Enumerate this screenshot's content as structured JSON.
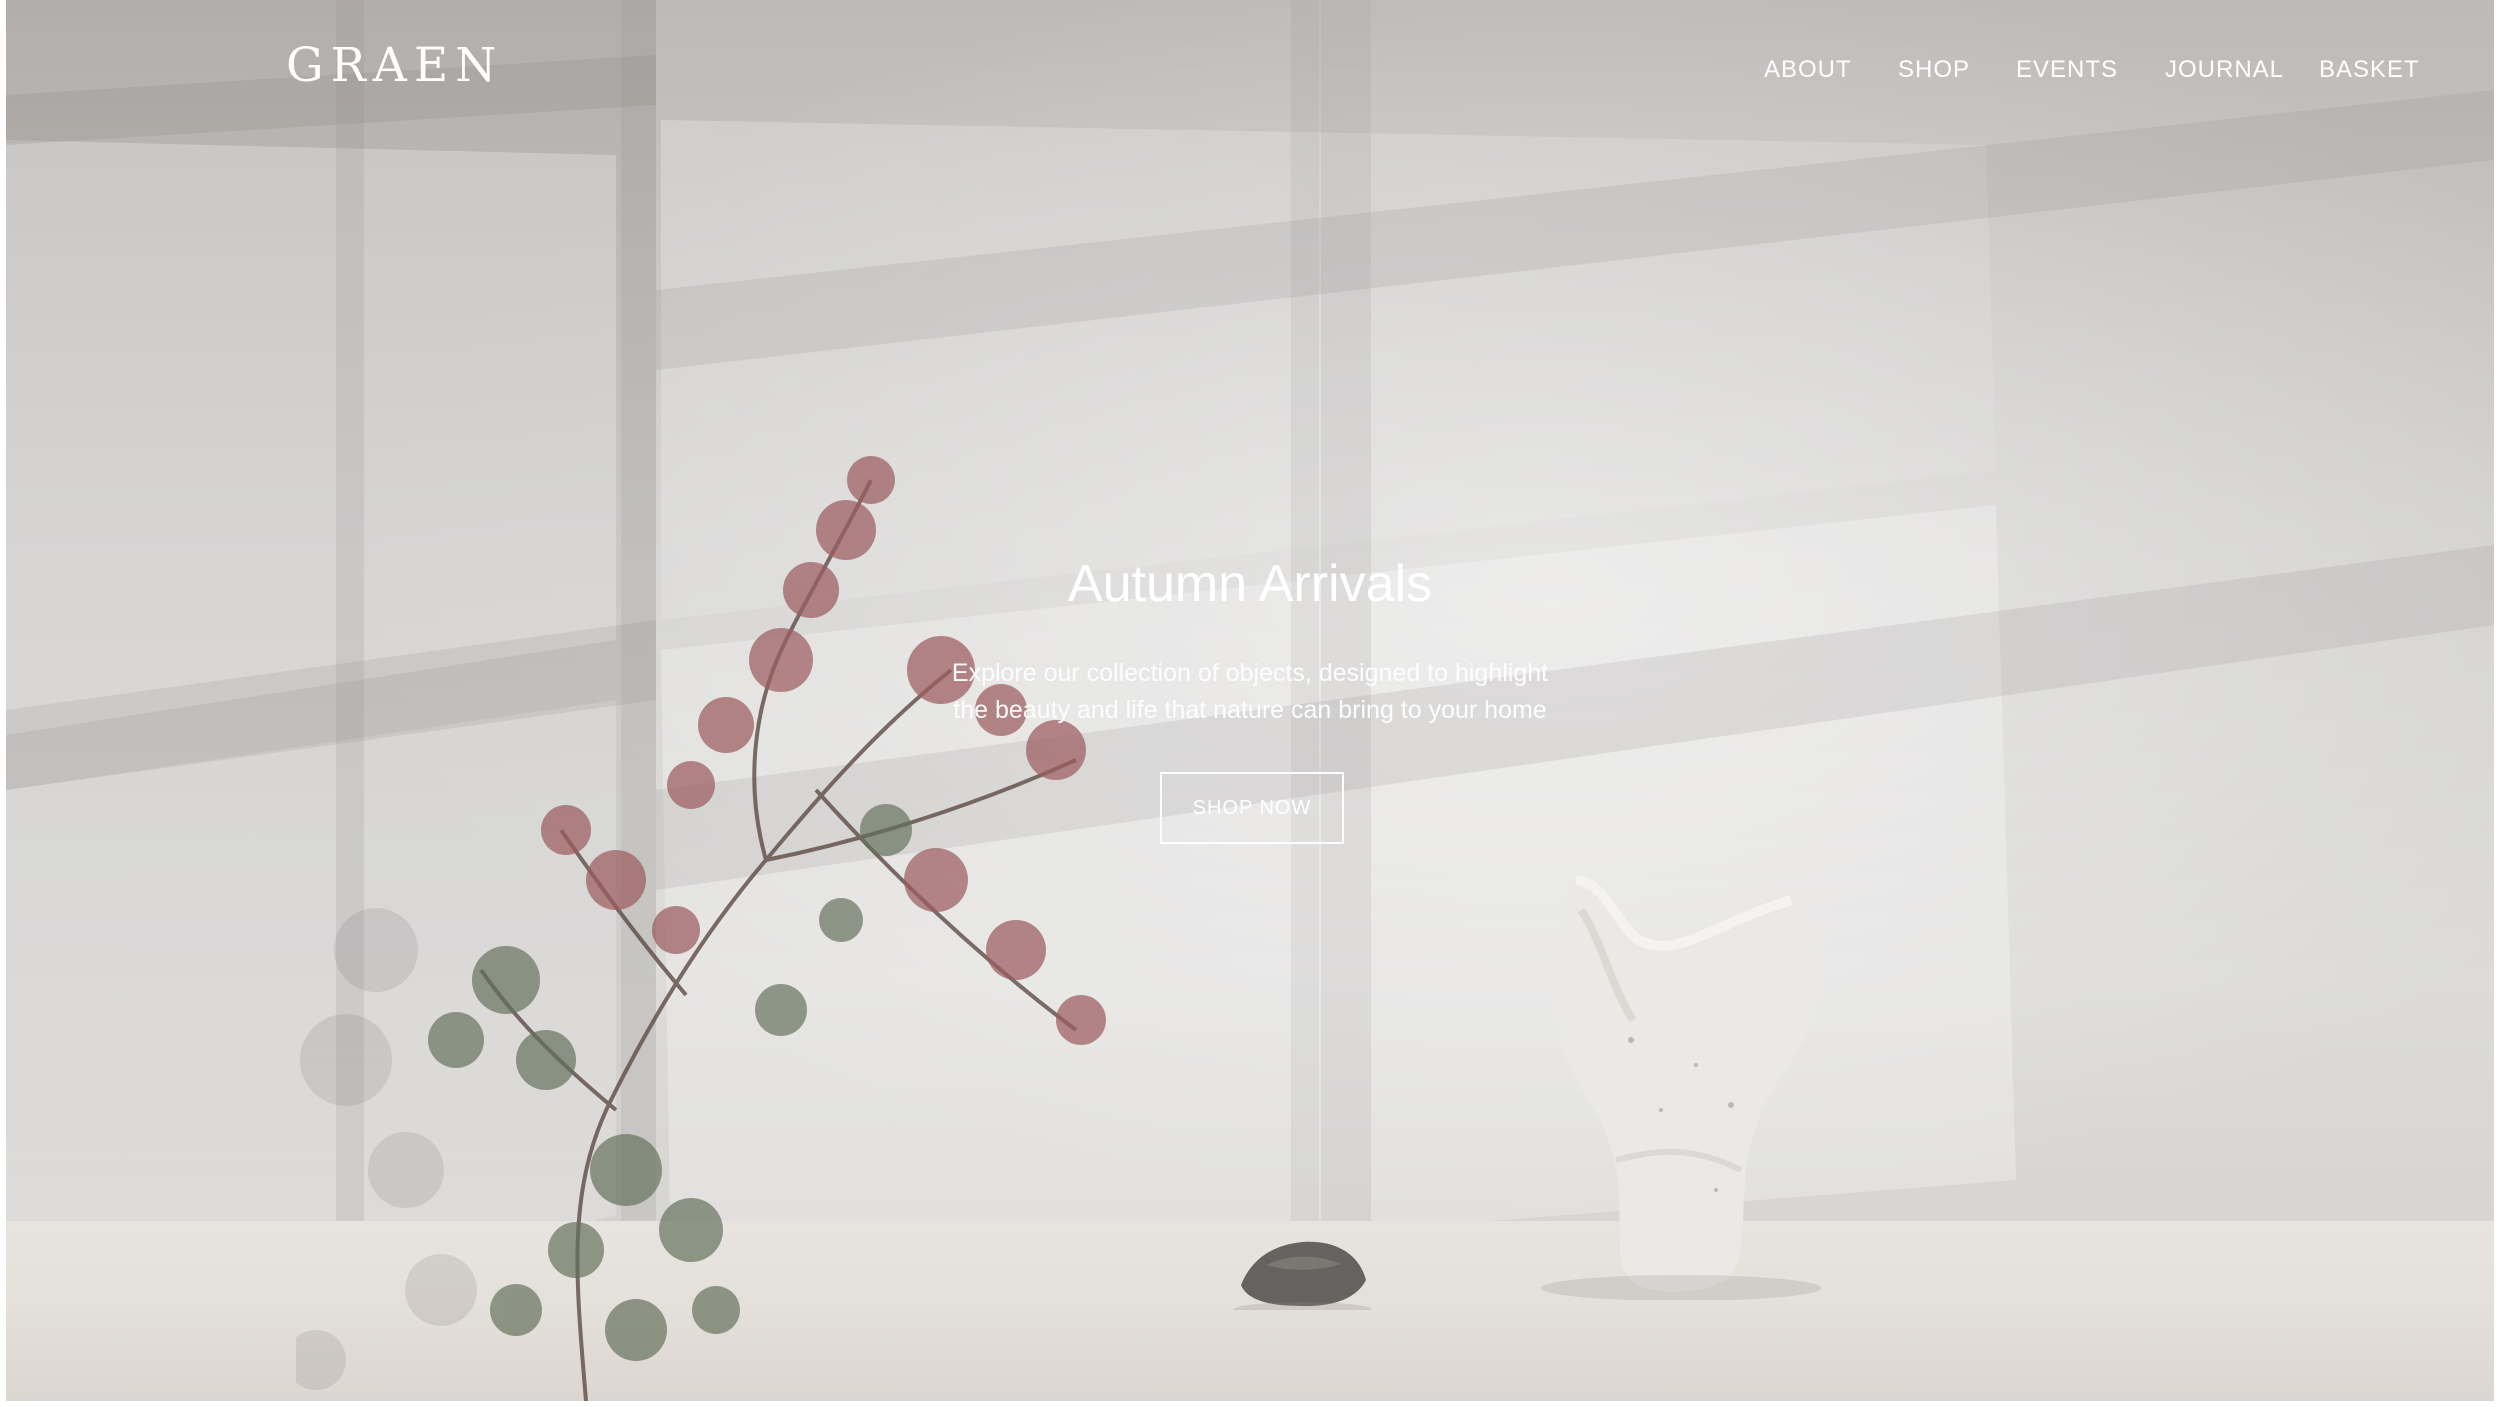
{
  "brand": {
    "logo_text": "GRAEN"
  },
  "navigation": {
    "items": [
      {
        "label": "ABOUT"
      },
      {
        "label": "SHOP"
      },
      {
        "label": "EVENTS"
      },
      {
        "label": "JOURNAL"
      },
      {
        "label": "BASKET"
      }
    ]
  },
  "hero": {
    "title": "Autumn Arrivals",
    "subtitle": "Explore our collection of objects, designed to highlight the beauty and life that nature can bring to your home",
    "button_label": "SHOP NOW",
    "image_elements": [
      "window-shadow-wall",
      "japanese-maple-branch",
      "white-ceramic-vase",
      "small-gray-stone",
      "linen-table-cloth"
    ]
  },
  "colors": {
    "text": "#ffffff",
    "background": "#d8d7d5",
    "plant_red": "#9d5d60",
    "plant_green": "#63705a",
    "vase": "#e9e7e4"
  }
}
